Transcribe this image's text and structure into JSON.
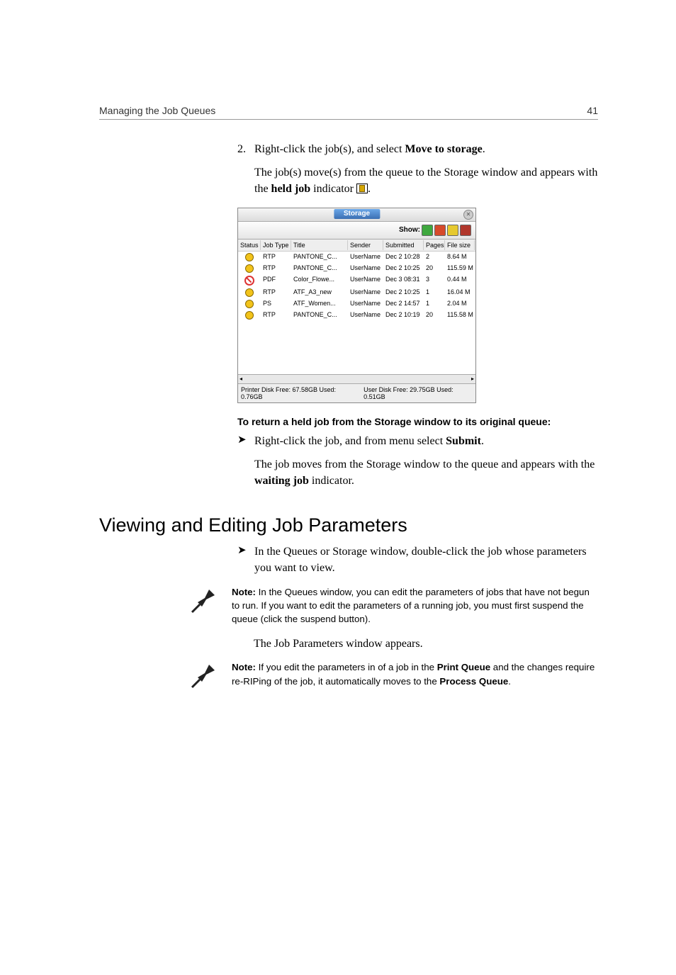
{
  "header": {
    "left": "Managing the Job Queues",
    "right": "41"
  },
  "step2": {
    "num": "2.",
    "text_a": "Right-click the job(s), and select ",
    "text_b": "Move to storage",
    "text_c": "."
  },
  "para1": {
    "a": "The job(s) move(s) from the queue to the Storage window and appears with the ",
    "b": "held job",
    "c": " indicator "
  },
  "storage": {
    "title": "Storage",
    "show_label": "Show:",
    "headers": [
      "Status",
      "Job Type",
      "Title",
      "Sender",
      "Submitted",
      "Pages",
      "File size"
    ],
    "rows": [
      {
        "status": "hold",
        "type": "RTP",
        "title": "PANTONE_C...",
        "sender": "UserName",
        "submitted": "Dec 2 10:28",
        "pages": "2",
        "size": "8.64 M"
      },
      {
        "status": "hold",
        "type": "RTP",
        "title": "PANTONE_C...",
        "sender": "UserName",
        "submitted": "Dec 2 10:25",
        "pages": "20",
        "size": "115.59 M"
      },
      {
        "status": "fail",
        "type": "PDF",
        "title": "Color_Flowe...",
        "sender": "UserName",
        "submitted": "Dec 3 08:31",
        "pages": "3",
        "size": "0.44 M"
      },
      {
        "status": "hold",
        "type": "RTP",
        "title": "ATF_A3_new",
        "sender": "UserName",
        "submitted": "Dec 2 10:25",
        "pages": "1",
        "size": "16.04 M"
      },
      {
        "status": "hold",
        "type": "PS",
        "title": "ATF_Women...",
        "sender": "UserName",
        "submitted": "Dec 2 14:57",
        "pages": "1",
        "size": "2.04 M"
      },
      {
        "status": "hold",
        "type": "RTP",
        "title": "PANTONE_C...",
        "sender": "UserName",
        "submitted": "Dec 2 10:19",
        "pages": "20",
        "size": "115.58 M"
      }
    ],
    "footer_left": "Printer Disk Free: 67.58GB Used: 0.76GB",
    "footer_right": "User Disk Free: 29.75GB Used: 0.51GB"
  },
  "return_heading": "To return a held job from the Storage window to its original queue:",
  "return_step": {
    "a": "Right-click the job, and from menu select ",
    "b": "Submit",
    "c": "."
  },
  "return_para": {
    "a": "The job moves from the Storage window to the queue and appears with the ",
    "b": "waiting job",
    "c": " indicator."
  },
  "section_heading": "Viewing and Editing Job Parameters",
  "view_step": "In the Queues or Storage window, double-click the job whose parameters you want to view.",
  "note1": {
    "label": "Note:  ",
    "text": "In the Queues window, you can edit the parameters of jobs that have not begun to run. If you want to edit the parameters of a running job, you must first suspend the queue (click the suspend button)."
  },
  "appears_text": "The Job Parameters window appears.",
  "note2": {
    "label": "Note:  ",
    "a": "If you edit the parameters in of a job in the ",
    "b": "Print Queue",
    "c": " and the changes require re-RIPing of the job, it automatically moves to the ",
    "d": "Process Queue",
    "e": "."
  }
}
